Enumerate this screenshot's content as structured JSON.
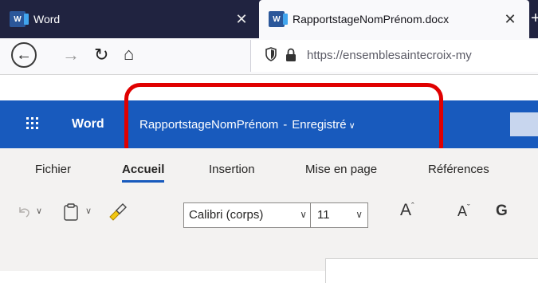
{
  "browser": {
    "tabs": [
      {
        "title": "Word",
        "close": "✕",
        "favicon": "word-favicon"
      },
      {
        "title": "RapportstageNomPrénom.docx",
        "close": "✕",
        "favicon": "word-favicon"
      }
    ],
    "url": "https://ensemblesaintecroix-my"
  },
  "app": {
    "name": "Word",
    "document_name": "RapportstageNomPrénom",
    "separator": "-",
    "save_status": "Enregistré",
    "brand_color": "#185abd"
  },
  "ribbon": {
    "tabs": [
      "Fichier",
      "Accueil",
      "Insertion",
      "Mise en page",
      "Références"
    ],
    "active_tab": "Accueil"
  },
  "toolbar": {
    "font_name": "Calibri (corps)",
    "font_size": "11",
    "grow_font": "A",
    "shrink_font": "A",
    "bold": "G"
  },
  "annotation": {
    "color": "#e00000"
  }
}
